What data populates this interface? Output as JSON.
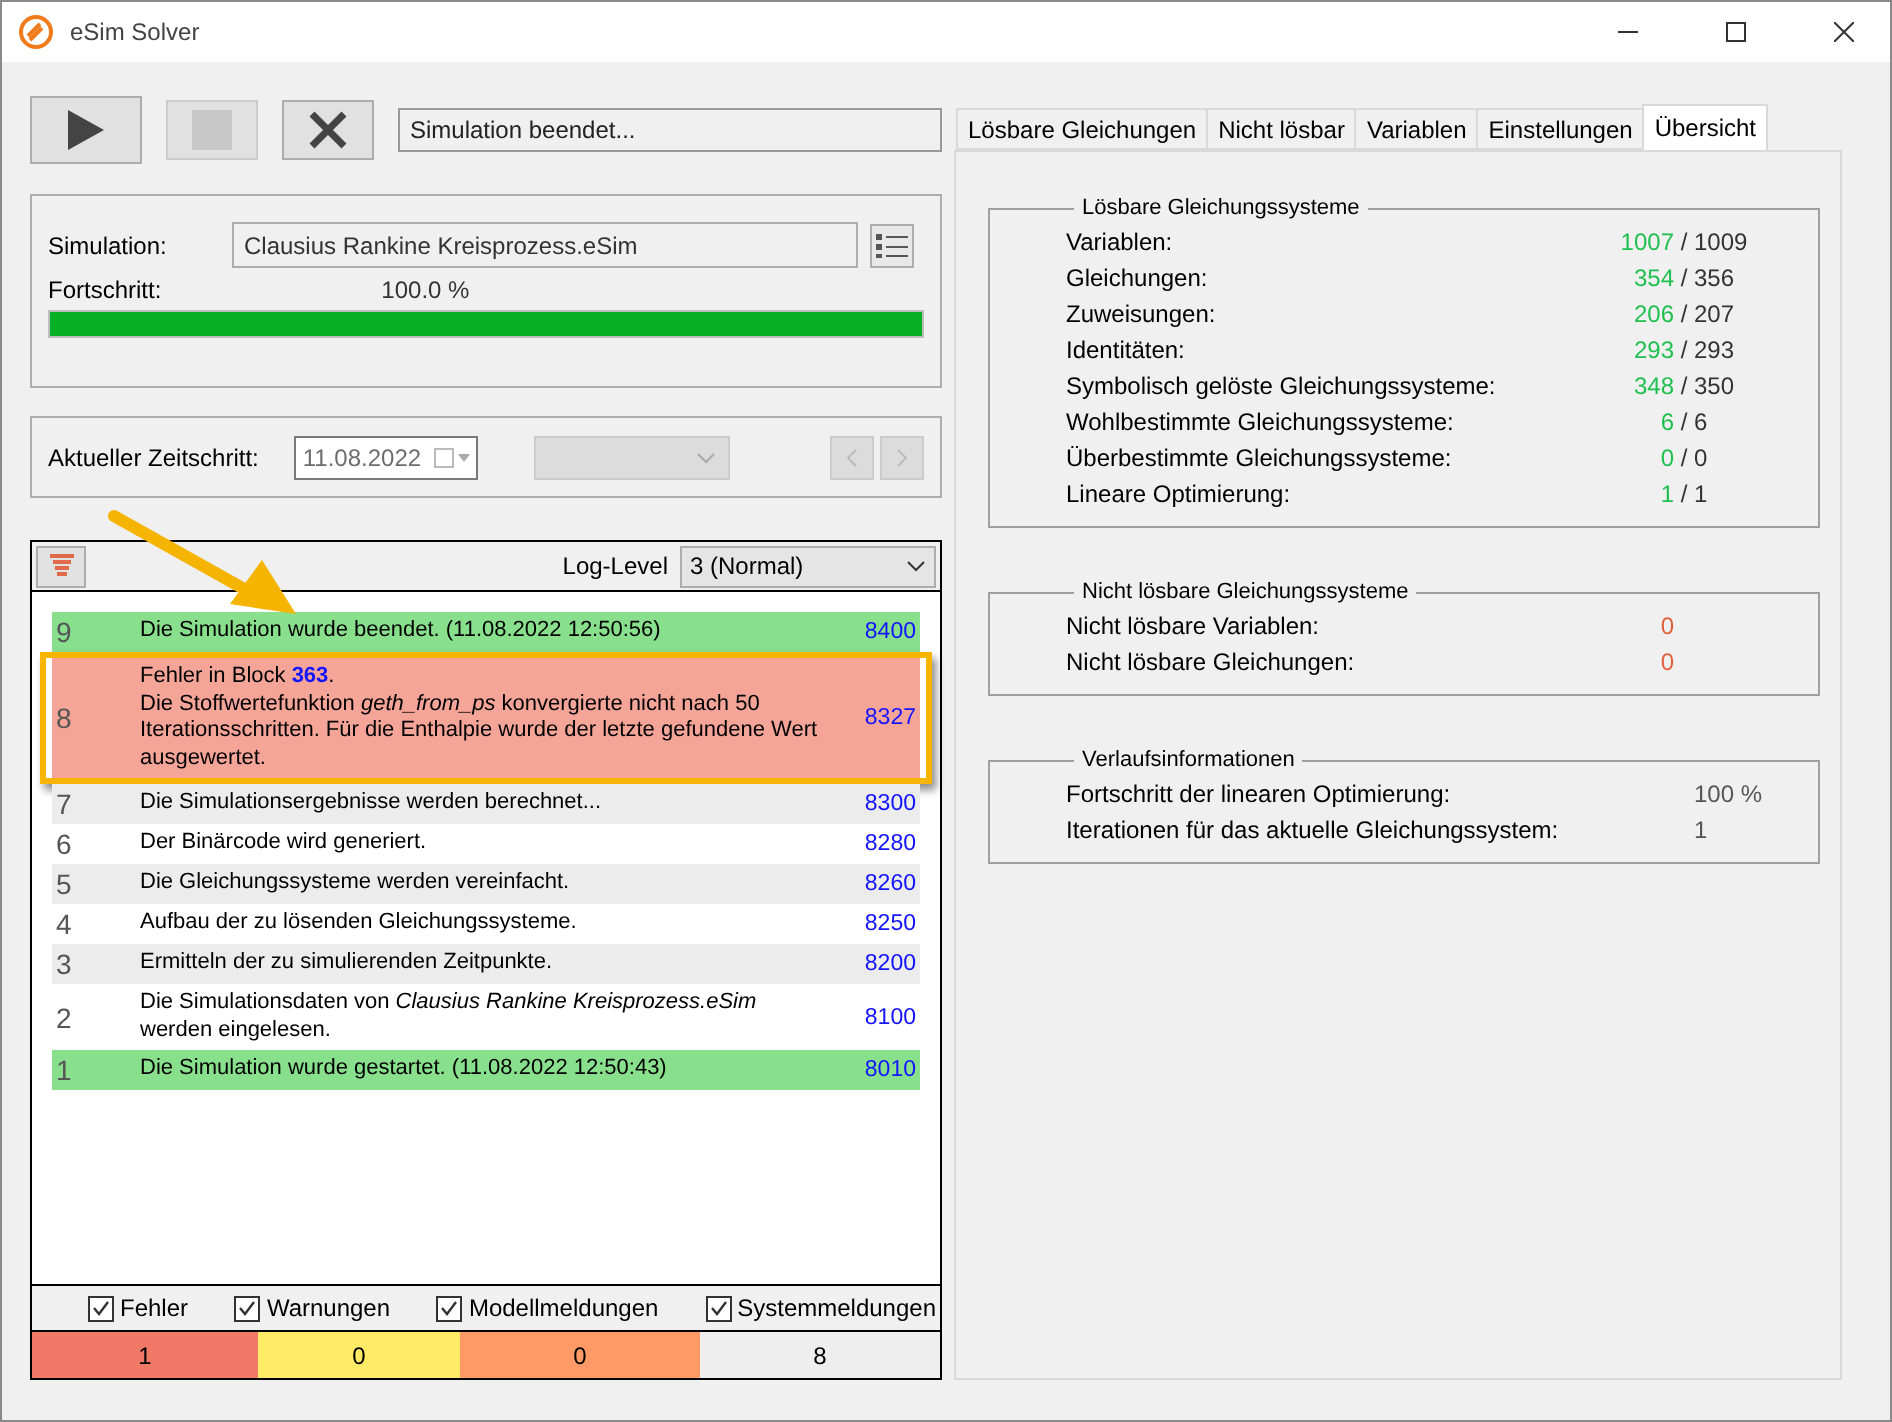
{
  "window": {
    "title": "eSim Solver"
  },
  "toolbar": {
    "status": "Simulation beendet..."
  },
  "simulation": {
    "label": "Simulation:",
    "file": "Clausius Rankine Kreisprozess.eSim",
    "progress_label": "Fortschritt:",
    "progress_text": "100.0 %",
    "level": 1.0
  },
  "timestep": {
    "label": "Aktueller Zeitschritt:",
    "date": "11.08.2022"
  },
  "log": {
    "level_label": "Log-Level",
    "level_value": "3 (Normal)",
    "rows": [
      {
        "number": "9",
        "kind": "success",
        "highlighted": false,
        "lines": [
          "Die Simulation wurde beendet. (11.08.2022 12:50:56)"
        ],
        "code": "8400"
      },
      {
        "number": "8",
        "kind": "error",
        "highlighted": true,
        "lines": [
          "Fehler in Block **363**.",
          "Die Stoffwertefunktion *geth_from_ps* konvergierte nicht nach 50 Iterationsschritten. Für die Enthalpie wurde der letzte gefundene Wert ausgewertet."
        ],
        "code": "8327"
      },
      {
        "number": "7",
        "kind": "plain",
        "highlighted": false,
        "lines": [
          "Die Simulationsergebnisse werden berechnet..."
        ],
        "code": "8300"
      },
      {
        "number": "6",
        "kind": "plain",
        "highlighted": false,
        "lines": [
          "Der Binärcode wird generiert."
        ],
        "code": "8280"
      },
      {
        "number": "5",
        "kind": "plain",
        "highlighted": false,
        "lines": [
          "Die Gleichungssysteme werden vereinfacht."
        ],
        "code": "8260"
      },
      {
        "number": "4",
        "kind": "plain",
        "highlighted": false,
        "lines": [
          "Aufbau der zu lösenden Gleichungssysteme."
        ],
        "code": "8250"
      },
      {
        "number": "3",
        "kind": "plain",
        "highlighted": false,
        "lines": [
          "Ermitteln der zu simulierenden Zeitpunkte."
        ],
        "code": "8200"
      },
      {
        "number": "2",
        "kind": "plain",
        "highlighted": false,
        "lines": [
          "Die Simulationsdaten von *Clausius Rankine Kreisprozess.eSim* werden eingelesen."
        ],
        "code": "8100"
      },
      {
        "number": "1",
        "kind": "success",
        "highlighted": false,
        "lines": [
          "Die Simulation wurde gestartet. (11.08.2022 12:50:43)"
        ],
        "code": "8010"
      }
    ],
    "filters": [
      {
        "label": "Fehler",
        "checked": true
      },
      {
        "label": "Warnungen",
        "checked": true
      },
      {
        "label": "Modellmeldungen",
        "checked": true
      },
      {
        "label": "Systemmeldungen",
        "checked": true
      }
    ],
    "counters": [
      {
        "value": "1",
        "color": "#ef7866"
      },
      {
        "value": "0",
        "color": "#ffeb66"
      },
      {
        "value": "0",
        "color": "#ff9966"
      },
      {
        "value": "8",
        "color": "#eeeeee"
      }
    ]
  },
  "tabs": [
    {
      "label": "Lösbare Gleichungen",
      "selected": false
    },
    {
      "label": "Nicht lösbar",
      "selected": false
    },
    {
      "label": "Variablen",
      "selected": false
    },
    {
      "label": "Einstellungen",
      "selected": false
    },
    {
      "label": "Übersicht",
      "selected": true
    }
  ],
  "groups": [
    {
      "title": "Lösbare Gleichungssysteme",
      "kind": "ratio",
      "separator": "/",
      "rows": [
        {
          "label": "Variablen:",
          "solved": "1007",
          "total": "1009"
        },
        {
          "label": "Gleichungen:",
          "solved": "354",
          "total": "356"
        },
        {
          "label": "Zuweisungen:",
          "solved": "206",
          "total": "207"
        },
        {
          "label": "Identitäten:",
          "solved": "293",
          "total": "293"
        },
        {
          "label": "Symbolisch gelöste Gleichungssysteme:",
          "solved": "348",
          "total": "350"
        },
        {
          "label": "Wohlbestimmte Gleichungssysteme:",
          "solved": "6",
          "total": "6"
        },
        {
          "label": "Überbestimmte Gleichungssysteme:",
          "solved": "0",
          "total": "0"
        },
        {
          "label": "Lineare Optimierung:",
          "solved": "1",
          "total": "1"
        }
      ]
    },
    {
      "title": "Nicht lösbare Gleichungssysteme",
      "kind": "unsolved",
      "rows": [
        {
          "label": "Nicht lösbare Variablen:",
          "value": "0"
        },
        {
          "label": "Nicht lösbare Gleichungen:",
          "value": "0"
        }
      ]
    },
    {
      "title": "Verlaufsinformationen",
      "kind": "info",
      "rows": [
        {
          "label": "Fortschritt der linearen Optimierung:",
          "value": "100 %"
        },
        {
          "label": "Iterationen für das aktuelle Gleichungssystem:",
          "value": "1"
        }
      ]
    }
  ]
}
